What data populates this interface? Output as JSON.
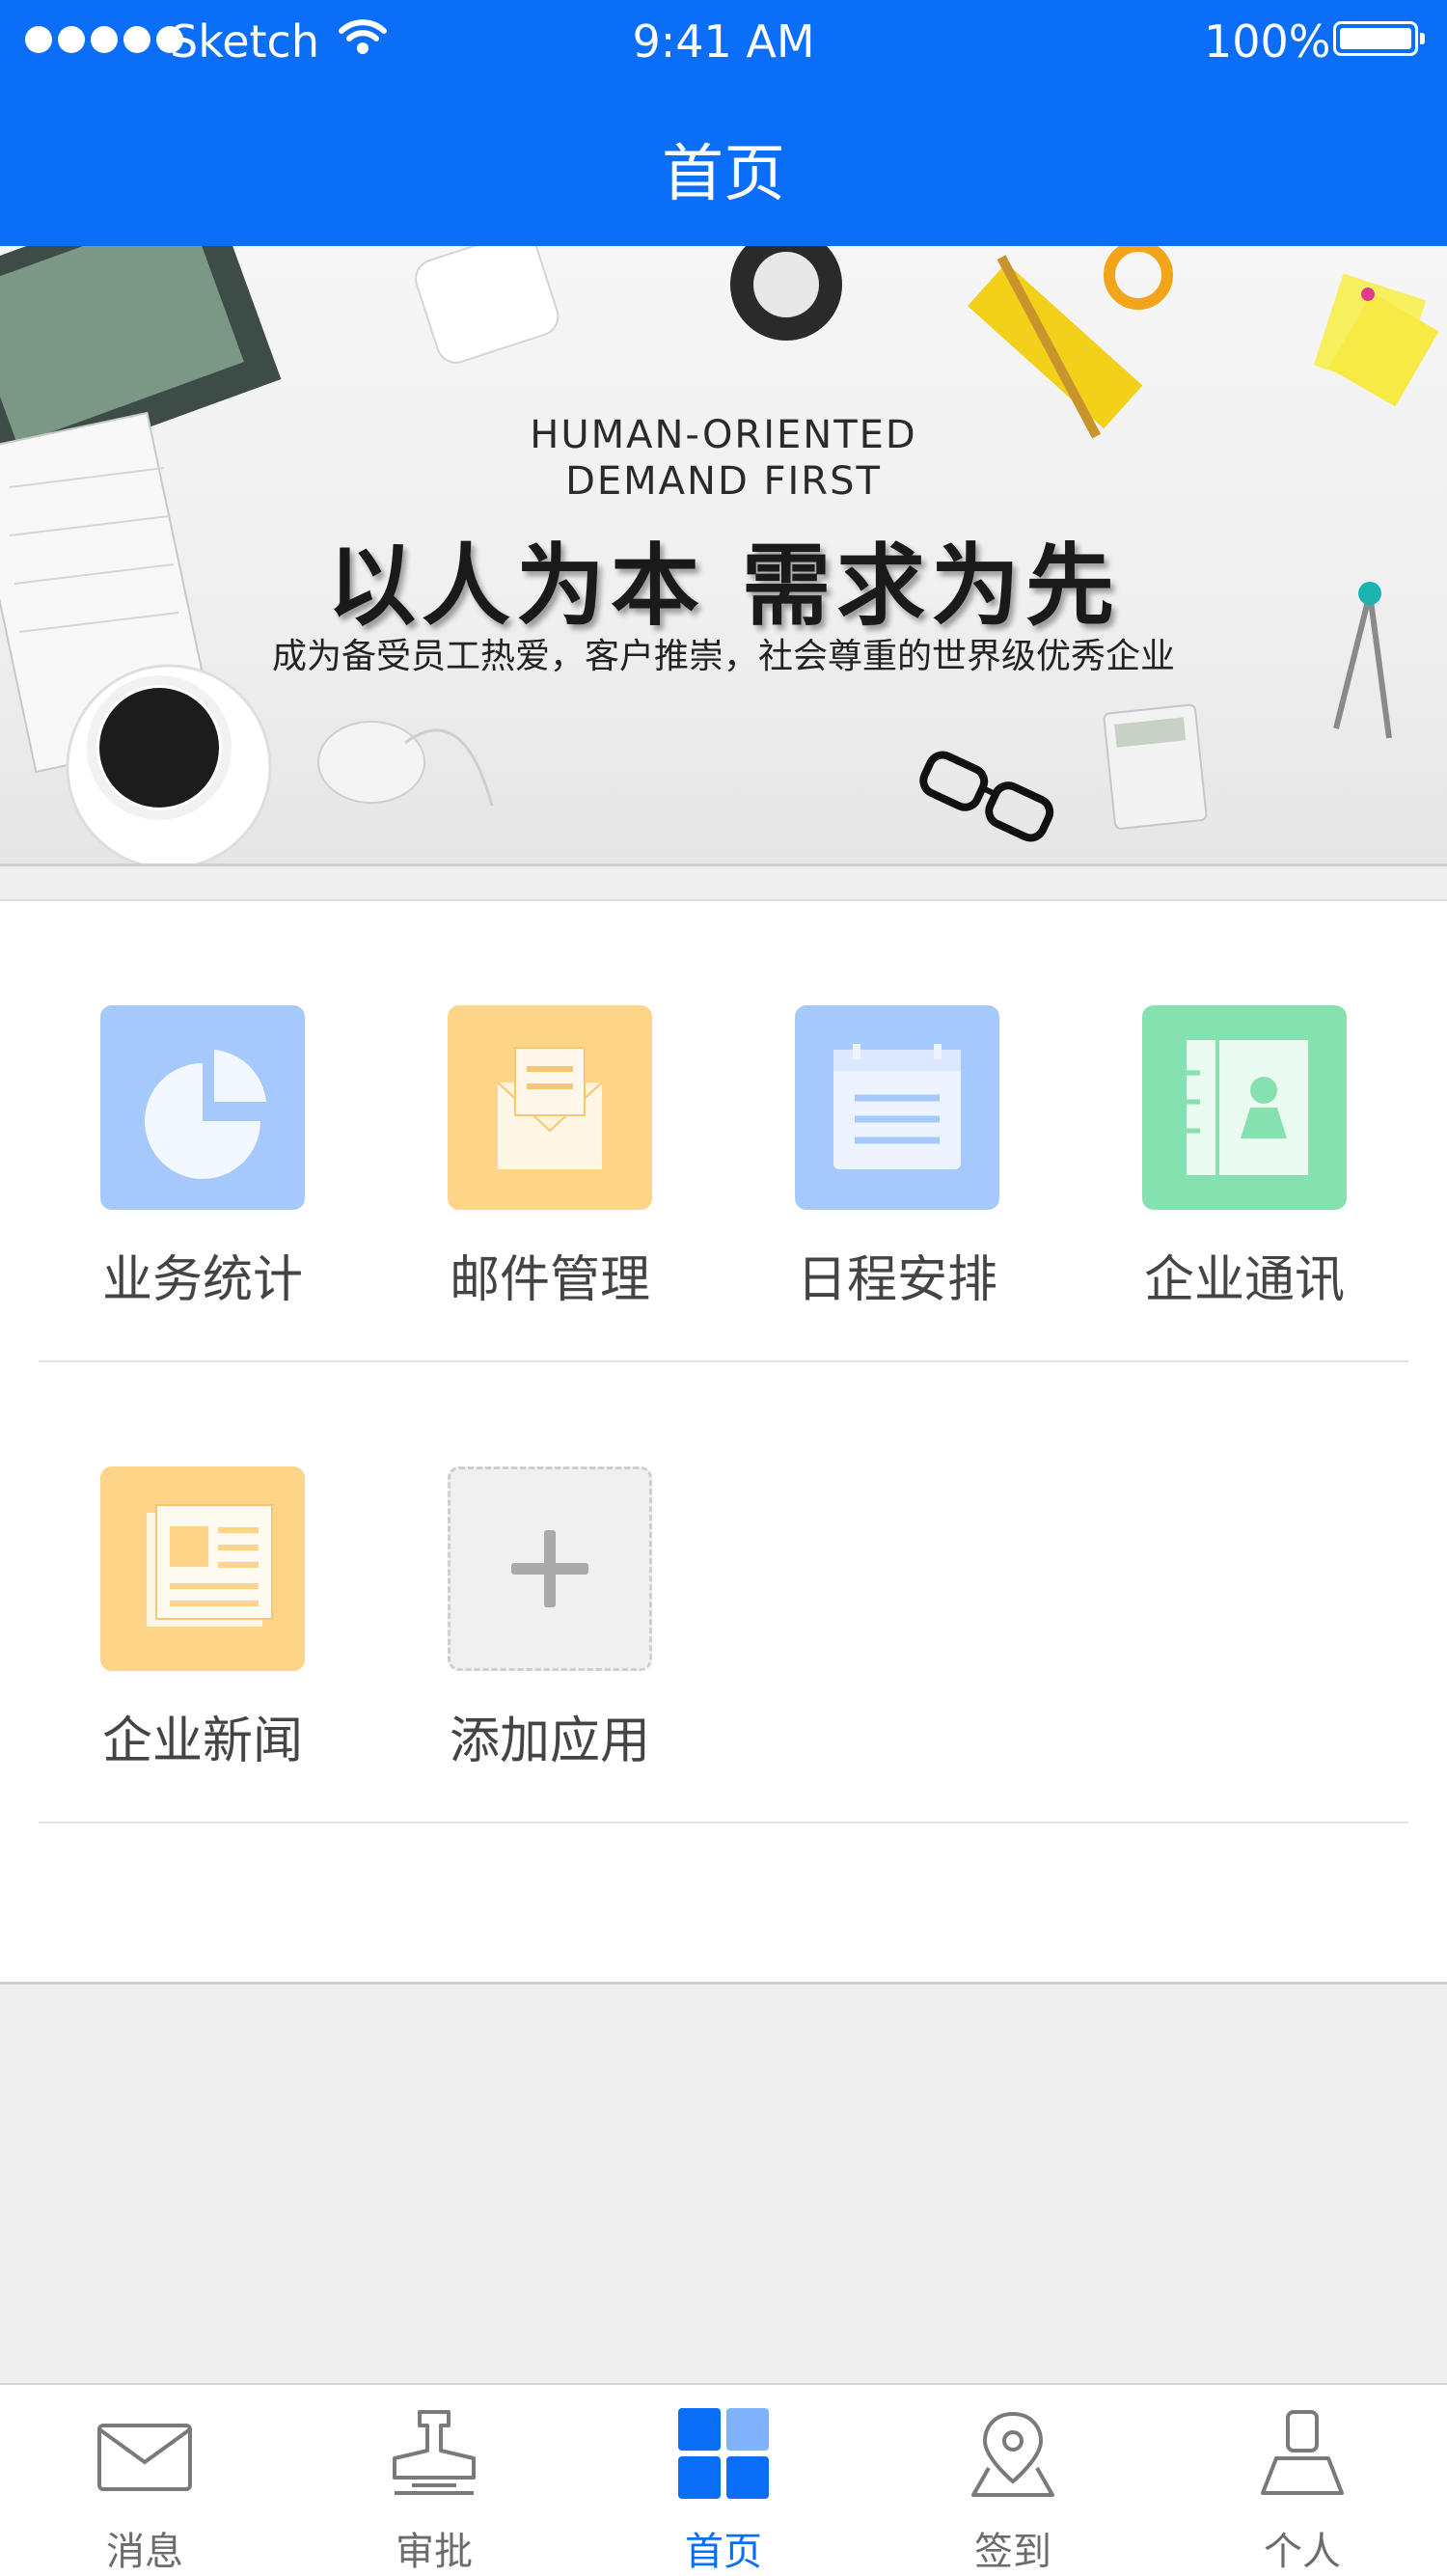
{
  "status_bar": {
    "carrier": "Sketch",
    "time": "9:41 AM",
    "battery": "100%"
  },
  "nav": {
    "title": "首页"
  },
  "banner": {
    "english_line1": "HUMAN-ORIENTED",
    "english_line2": "DEMAND FIRST",
    "slogan": "以人为本 需求为先",
    "subtitle": "成为备受员工热爱，客户推崇，社会尊重的世界级优秀企业"
  },
  "apps": [
    {
      "label": "业务统计",
      "icon": "pie-chart-icon",
      "color": "#a6c9fb"
    },
    {
      "label": "邮件管理",
      "icon": "envelope-icon",
      "color": "#fdd488"
    },
    {
      "label": "日程安排",
      "icon": "calendar-icon",
      "color": "#a6c9fb"
    },
    {
      "label": "企业通讯",
      "icon": "contacts-book-icon",
      "color": "#86e1b0"
    },
    {
      "label": "企业新闻",
      "icon": "newspaper-icon",
      "color": "#fdd488"
    },
    {
      "label": "添加应用",
      "icon": "plus-icon",
      "color": "#f0f0f0"
    }
  ],
  "tabbar": {
    "accent": "#0a6ef9",
    "items": [
      {
        "label": "消息",
        "icon": "envelope-outline-icon",
        "active": false
      },
      {
        "label": "审批",
        "icon": "stamp-icon",
        "active": false
      },
      {
        "label": "首页",
        "icon": "grid-home-icon",
        "active": true
      },
      {
        "label": "签到",
        "icon": "location-pin-icon",
        "active": false
      },
      {
        "label": "个人",
        "icon": "person-icon",
        "active": false
      }
    ]
  }
}
